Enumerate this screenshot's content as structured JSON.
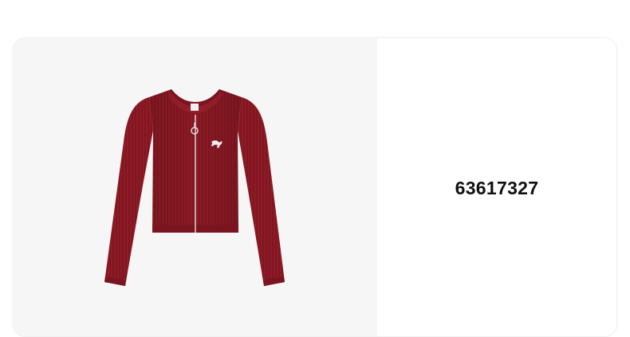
{
  "product": {
    "code": "63617327",
    "image": {
      "subject": "jacket-image",
      "garment_color": "#8e1b25",
      "background_color": "#f6f6f6"
    }
  }
}
